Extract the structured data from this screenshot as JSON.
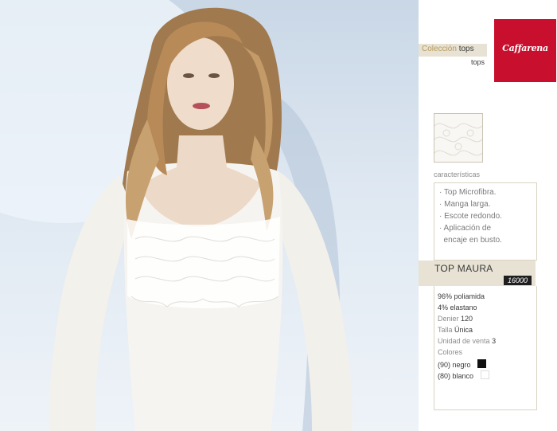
{
  "collection": {
    "label_prefix": "Colección",
    "label_category": "tops",
    "subcategory": "tops"
  },
  "brand": {
    "logo_text": "Caffarena",
    "color": "#c8102e"
  },
  "features": {
    "title": "características",
    "items": [
      "· Top Microfibra.",
      "· Manga larga.",
      "· Escote redondo.",
      "· Aplicación de",
      "  encaje en busto."
    ]
  },
  "product": {
    "name": "TOP MAURA",
    "code": "16000"
  },
  "specs": {
    "composition": [
      "96% poliamida",
      "4% elastano"
    ],
    "denier_label": "Denier",
    "denier_value": "120",
    "size_label": "Talla",
    "size_value": "Única",
    "unit_label": "Unidad de venta",
    "unit_value": "3",
    "colors_label": "Colores",
    "colors": [
      {
        "label": "(90) negro",
        "hex": "#111111"
      },
      {
        "label": "(80) blanco",
        "hex": "#ffffff"
      }
    ]
  }
}
